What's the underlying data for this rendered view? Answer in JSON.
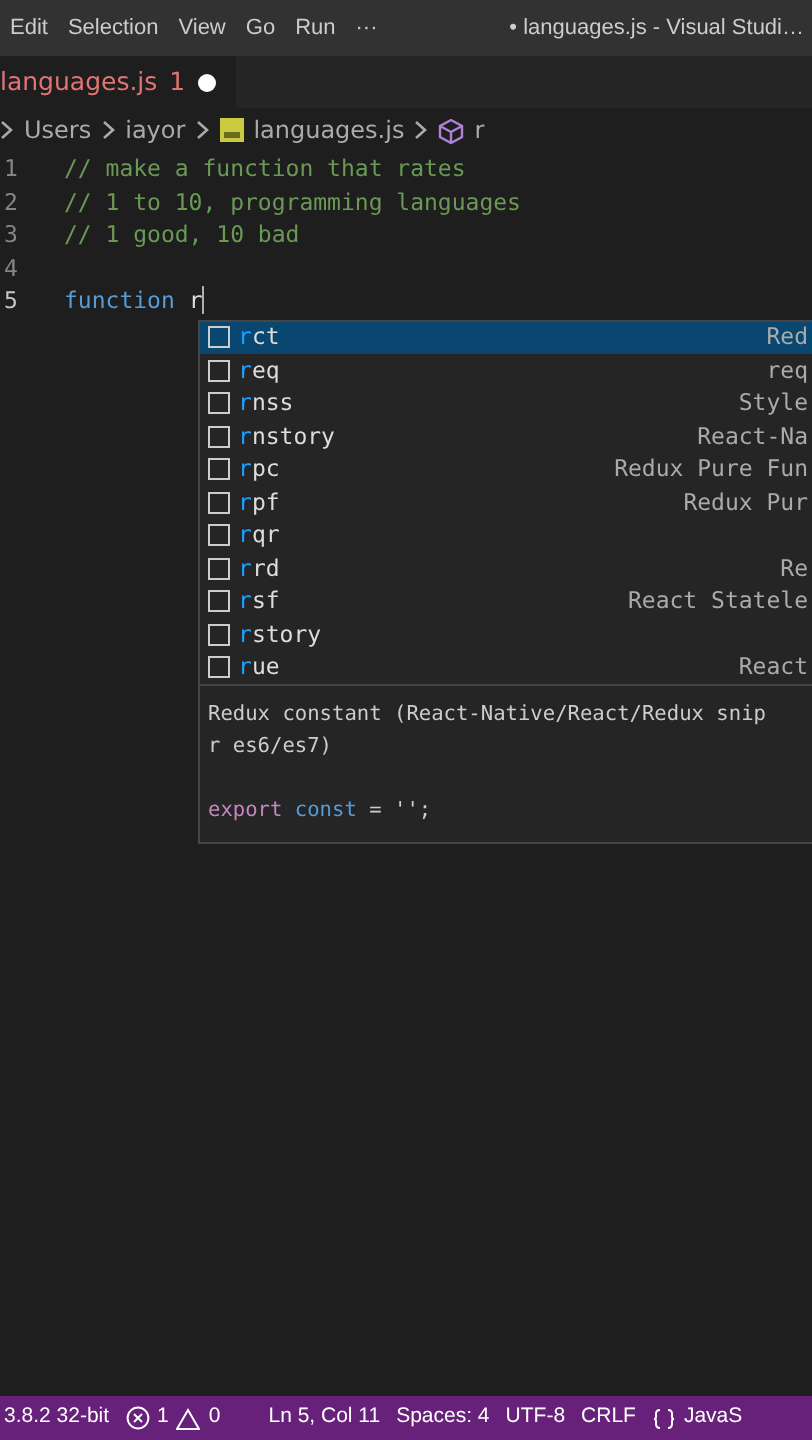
{
  "menu_bar": {
    "items": [
      "Edit",
      "Selection",
      "View",
      "Go",
      "Run",
      "···"
    ],
    "title": "• languages.js - Visual Studi…"
  },
  "tab": {
    "label": "languages.js",
    "problems": "1",
    "dirty": true,
    "selected": true
  },
  "breadcrumb": [
    "Users",
    "iayor",
    "languages.js",
    "r"
  ],
  "editor": {
    "lines": [
      {
        "number": "1",
        "kind": "comment",
        "text": "// make a function that rates",
        "current": false
      },
      {
        "number": "2",
        "kind": "comment",
        "text": "// 1 to 10, programming languages",
        "current": false
      },
      {
        "number": "3",
        "kind": "comment",
        "text": "// 1 good, 10 bad",
        "current": false
      },
      {
        "number": "4",
        "kind": "blank",
        "current": false
      },
      {
        "number": "5",
        "kind": "code",
        "keyword": "function",
        "text": "r",
        "current": true
      }
    ]
  },
  "suggestions": [
    {
      "label": "rct",
      "detail": "Red",
      "selected": true
    },
    {
      "label": "req",
      "detail": "req",
      "selected": false
    },
    {
      "label": "rnss",
      "detail": "Style",
      "selected": false
    },
    {
      "label": "rnstory",
      "detail": "React-Na",
      "selected": false
    },
    {
      "label": "rpc",
      "detail": "Redux Pure Fun",
      "selected": false
    },
    {
      "label": "rpf",
      "detail": "Redux Pur",
      "selected": false
    },
    {
      "label": "rqr",
      "selected": false
    },
    {
      "label": "rrd",
      "detail": "Re",
      "selected": false
    },
    {
      "label": "rsf",
      "detail": "React Statele",
      "selected": false
    },
    {
      "label": "rstory",
      "selected": false
    },
    {
      "label": "rue",
      "detail": "React",
      "selected": false
    }
  ],
  "details": {
    "description": [
      "Redux constant (React-Native/React/Redux snip",
      "r es6/es7)"
    ],
    "code": {
      "keyword": "export",
      "storage": "const",
      "rest": " = '';"
    }
  },
  "status_bar": {
    "interpreter": "3.8.2 32-bit",
    "errors": "1",
    "warnings": "0",
    "position": "Ln 5, Col 11",
    "indent": "Spaces: 4",
    "encoding": "UTF-8",
    "eol": "CRLF",
    "language": "JavaS"
  }
}
